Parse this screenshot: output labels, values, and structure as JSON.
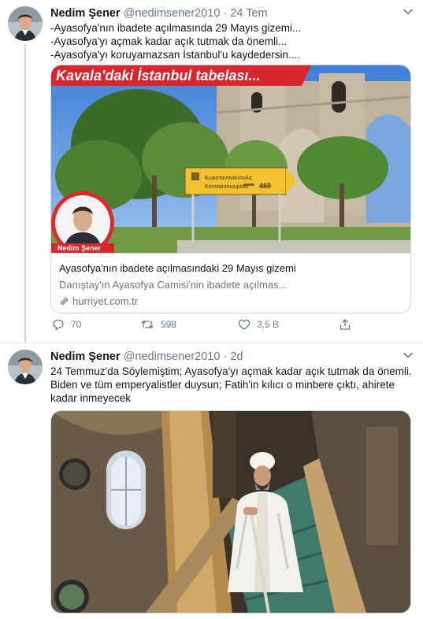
{
  "tweets": [
    {
      "name": "Nedim Şener",
      "handle": "@nedimsener2010",
      "separator": "·",
      "time": "24 Tem",
      "lines": [
        "-Ayasofya'nın ibadete açılmasında 29 Mayıs gizemi...",
        "-Ayasofya'yı açmak kadar açık tutmak da önemli...",
        "-Ayasofya'yı koruyamazsan İstanbul'u kaydedersin...."
      ],
      "card": {
        "banner_text": "Kavala'daki İstanbul tabelası...",
        "sign_text_1": "Κωνσταντινούπολις",
        "sign_text_2": "Konstantinoupolis",
        "sign_distance": "460",
        "author_label": "Nedim Şener",
        "title": "Ayasofya'nın ibadete açılmasındaki 29 Mayıs gizemi",
        "description": "Danıştay'ın Ayasofya Camisi'nin ibadete açılmas...",
        "link": "hurriyet.com.tr"
      },
      "actions": {
        "replies": "70",
        "retweets": "598",
        "likes": "3,5 B"
      }
    },
    {
      "name": "Nedim Şener",
      "handle": "@nedimsener2010",
      "separator": "·",
      "time": "2d",
      "lines": [
        "24 Temmuz'da Söylemiştim; Ayasofya'yı açmak kadar açık tutmak da önemli.",
        "Biden ve tüm emperyalistler duysun; Fatih'in kılıcı o minbere çıktı, ahirete",
        "kadar inmeyecek"
      ]
    }
  ],
  "colors": {
    "text": "#14171a",
    "secondary": "#657786",
    "border": "#ccd6dd",
    "banner_red": "#d9262c",
    "sign_yellow": "#f2c230"
  },
  "icons": [
    "chevron-down-icon",
    "reply-icon",
    "retweet-icon",
    "like-icon",
    "share-icon",
    "link-icon"
  ]
}
